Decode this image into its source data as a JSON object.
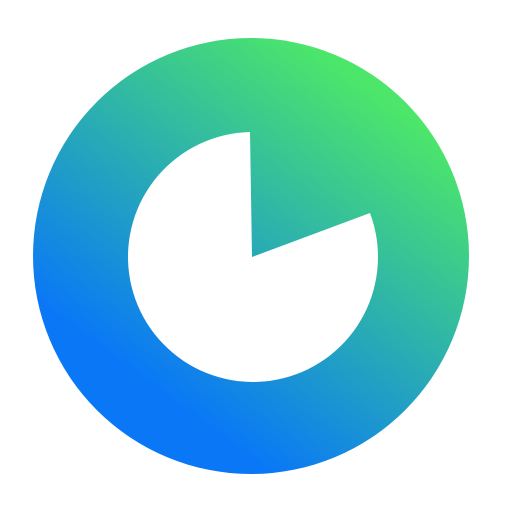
{
  "app_icon": {
    "icon_name": "pie-timer-logo-icon",
    "gradient_colors": {
      "top_right": "#4CE66A",
      "bottom_left": "#0A78F6"
    },
    "inner_color": "#FFFFFF"
  }
}
